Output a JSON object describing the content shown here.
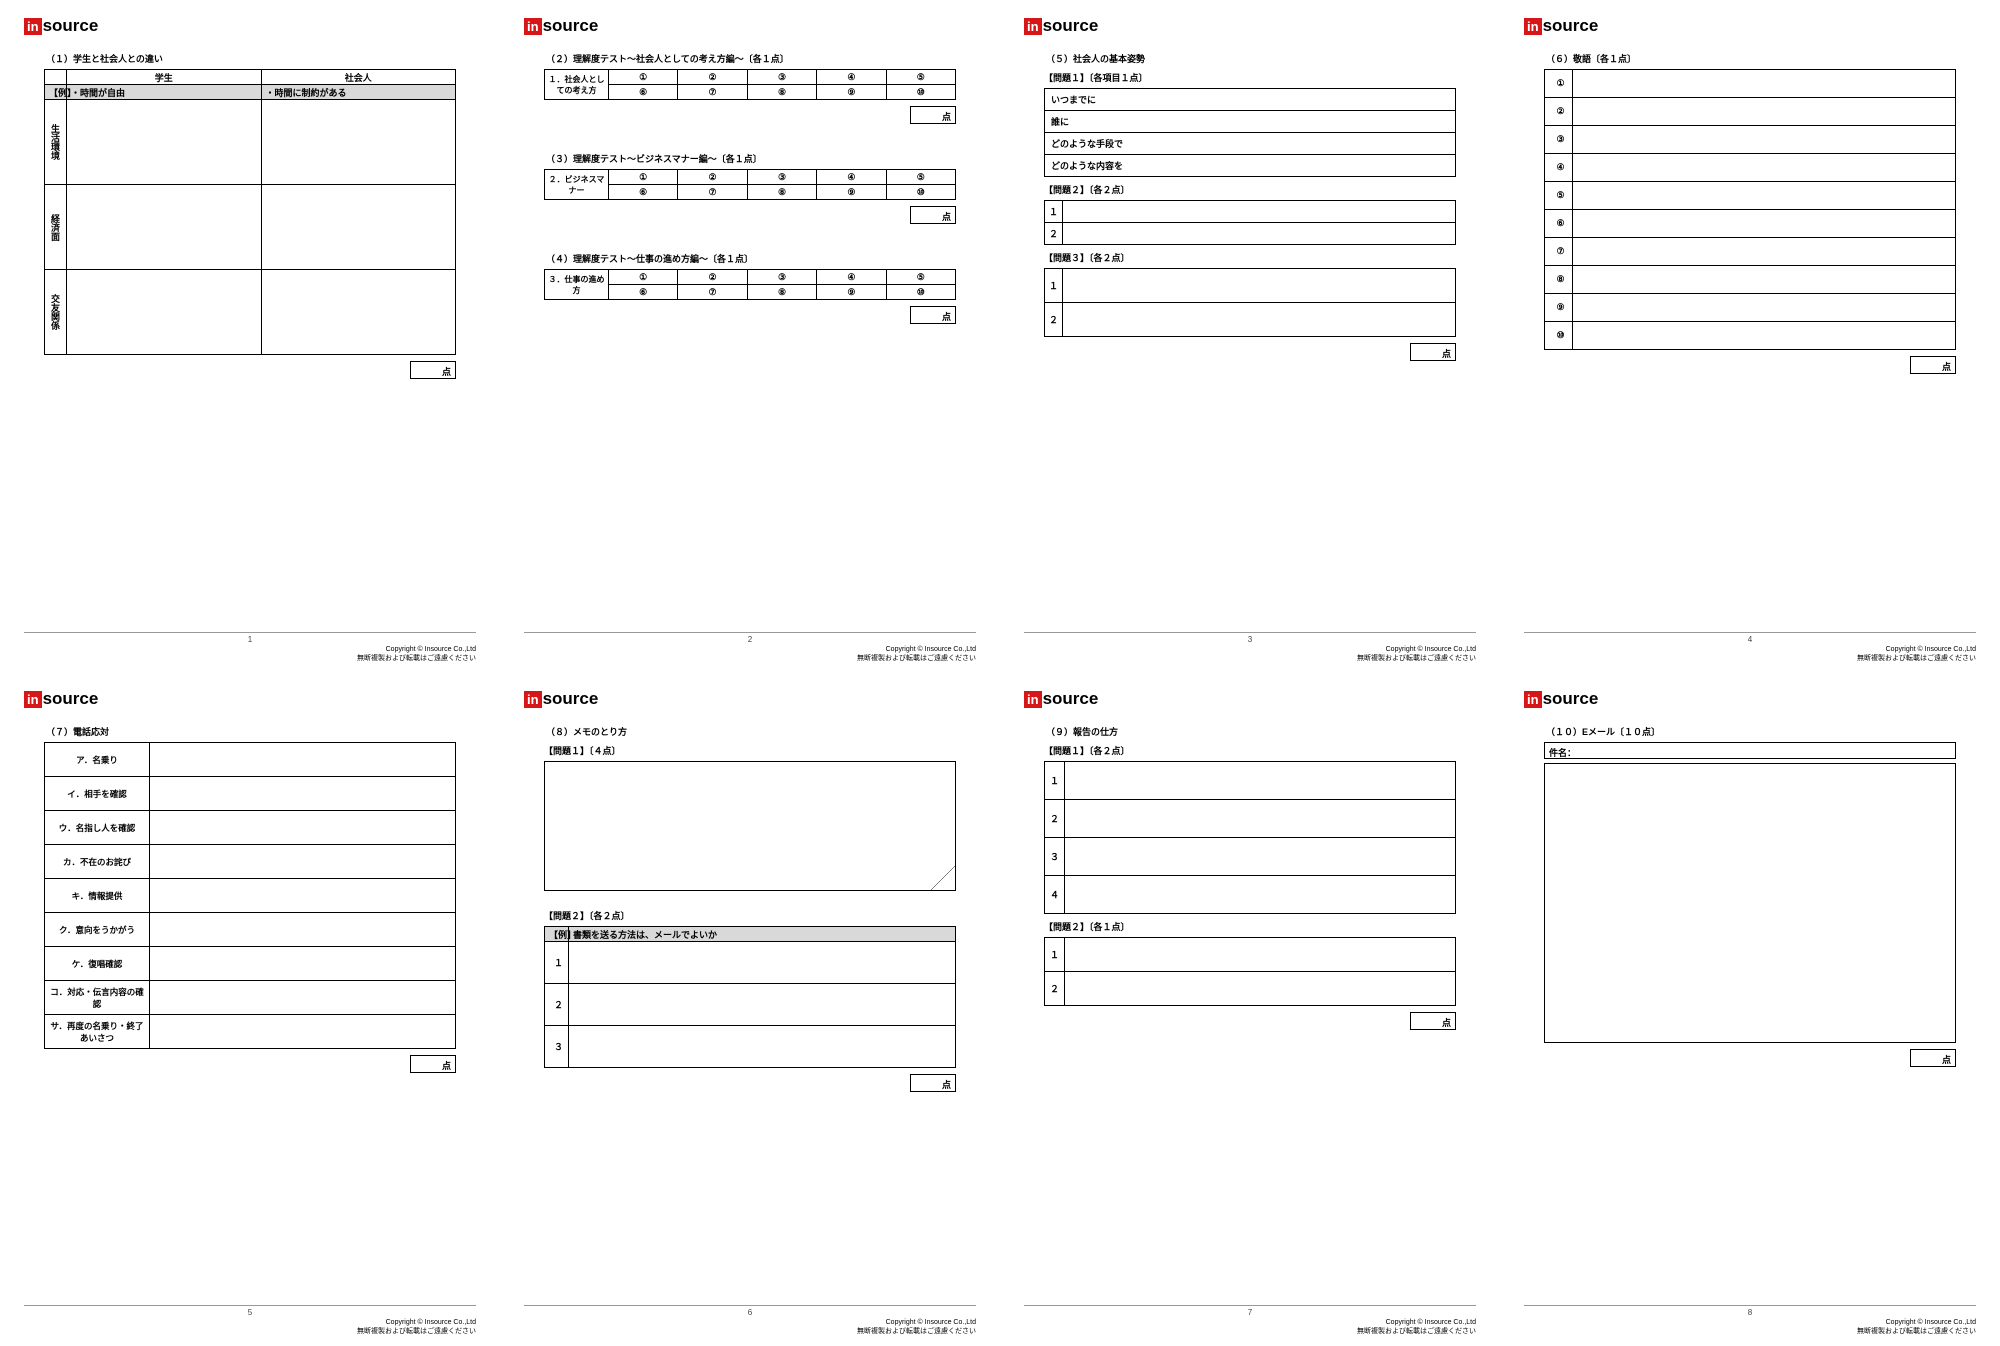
{
  "logo": {
    "in": "in",
    "source": "source"
  },
  "footer": {
    "copy1": "Copyright © Insource Co.,Ltd",
    "copy2": "無断複製および転載はご遠慮ください"
  },
  "score": "点",
  "p1": {
    "title": "（１）学生と社会人との違い",
    "hdr": [
      "学生",
      "社会人"
    ],
    "ex": "【例】",
    "exL": "・時間が自由",
    "exR": "・時間に制約がある",
    "rows": [
      "生活環境",
      "経済面",
      "交友関係"
    ]
  },
  "p2": {
    "s": [
      {
        "title": "（２）理解度テスト～社会人としての考え方編～〔各１点〕",
        "label": "１．社会人としての考え方"
      },
      {
        "title": "（３）理解度テスト～ビジネスマナー編～〔各１点〕",
        "label": "２．ビジネスマナー"
      },
      {
        "title": "（４）理解度テスト～仕事の進め方編～〔各１点〕",
        "label": "３．仕事の進め方"
      }
    ],
    "nums1": [
      "①",
      "②",
      "③",
      "④",
      "⑤"
    ],
    "nums2": [
      "⑥",
      "⑦",
      "⑧",
      "⑨",
      "⑩"
    ]
  },
  "p3": {
    "title": "（５）社会人の基本姿勢",
    "q1": "【問題１】〔各項目１点〕",
    "items": [
      "いつまでに",
      "誰に",
      "どのような手段で",
      "どのような内容を"
    ],
    "q2": "【問題２】〔各２点〕",
    "q3": "【問題３】〔各２点〕",
    "n": [
      "１",
      "２"
    ]
  },
  "p4": {
    "title": "（６）敬語〔各１点〕",
    "n": [
      "①",
      "②",
      "③",
      "④",
      "⑤",
      "⑥",
      "⑦",
      "⑧",
      "⑨",
      "⑩"
    ]
  },
  "p5": {
    "title": "（７）電話応対",
    "rows": [
      "ア．名乗り",
      "イ．相手を確認",
      "ウ．名指し人を確認",
      "カ．不在のお詫び",
      "キ．情報提供",
      "ク．意向をうかがう",
      "ケ．復唱確認",
      "コ．対応・伝言内容の確認",
      "サ．再度の名乗り・終了あいさつ"
    ]
  },
  "p6": {
    "title": "（８）メモのとり方",
    "q1": "【問題１】〔４点〕",
    "q2": "【問題２】〔各２点〕",
    "hdr": "【例】",
    "hdrTxt": "書類を送る方法は、メールでよいか",
    "n": [
      "１",
      "２",
      "３"
    ]
  },
  "p7": {
    "title": "（９）報告の仕方",
    "q1": "【問題１】〔各２点〕",
    "q2": "【問題２】〔各１点〕",
    "n1": [
      "１",
      "２",
      "３",
      "４"
    ],
    "n2": [
      "１",
      "２"
    ]
  },
  "p8": {
    "title": "（１０）Eメール〔１０点〕",
    "subj": "件名："
  },
  "pages": [
    "1",
    "2",
    "3",
    "4",
    "5",
    "6",
    "7",
    "8"
  ]
}
